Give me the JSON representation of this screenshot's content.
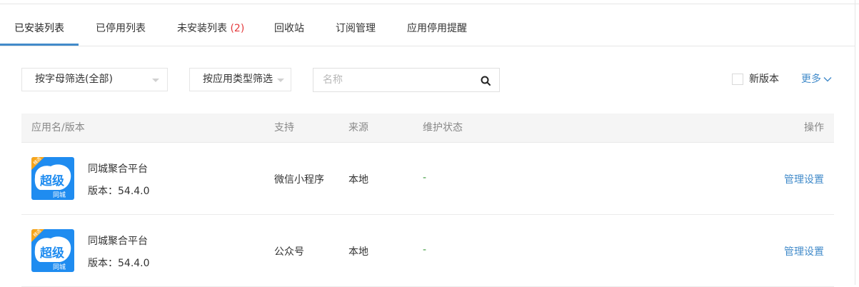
{
  "tabs": [
    {
      "label": "已安装列表",
      "count": ""
    },
    {
      "label": "已停用列表",
      "count": ""
    },
    {
      "label": "未安装列表",
      "count": "(2)"
    },
    {
      "label": "回收站",
      "count": ""
    },
    {
      "label": "订阅管理",
      "count": ""
    },
    {
      "label": "应用停用提醒",
      "count": ""
    }
  ],
  "active_tab": "已安装列表",
  "filters": {
    "letter_filter": "按字母筛选(全部)",
    "type_filter": "按应用类型筛选",
    "search_placeholder": "名称",
    "search_value": "",
    "new_version_label": "新版本",
    "new_version_checked": false,
    "more_label": "更多"
  },
  "table": {
    "headers": {
      "name": "应用名/版本",
      "support": "支持",
      "source": "来源",
      "status": "维护状态",
      "action": "操作"
    },
    "rows": [
      {
        "name": "同城聚合平台",
        "version": "版本：54.4.0",
        "support": "微信小程序",
        "source": "本地",
        "status": "-",
        "action": "管理设置"
      },
      {
        "name": "同城聚合平台",
        "version": "版本：54.4.0",
        "support": "公众号",
        "source": "本地",
        "status": "-",
        "action": "管理设置"
      }
    ]
  },
  "app_icon": {
    "badge": "精选",
    "main": "超级",
    "sub": "同城",
    "bg_color": "#1f8cf0",
    "badge_color": "#f7a51a"
  },
  "colors": {
    "accent": "#428bca",
    "status_green": "#3c9a3c",
    "count_red": "#e4393c"
  }
}
